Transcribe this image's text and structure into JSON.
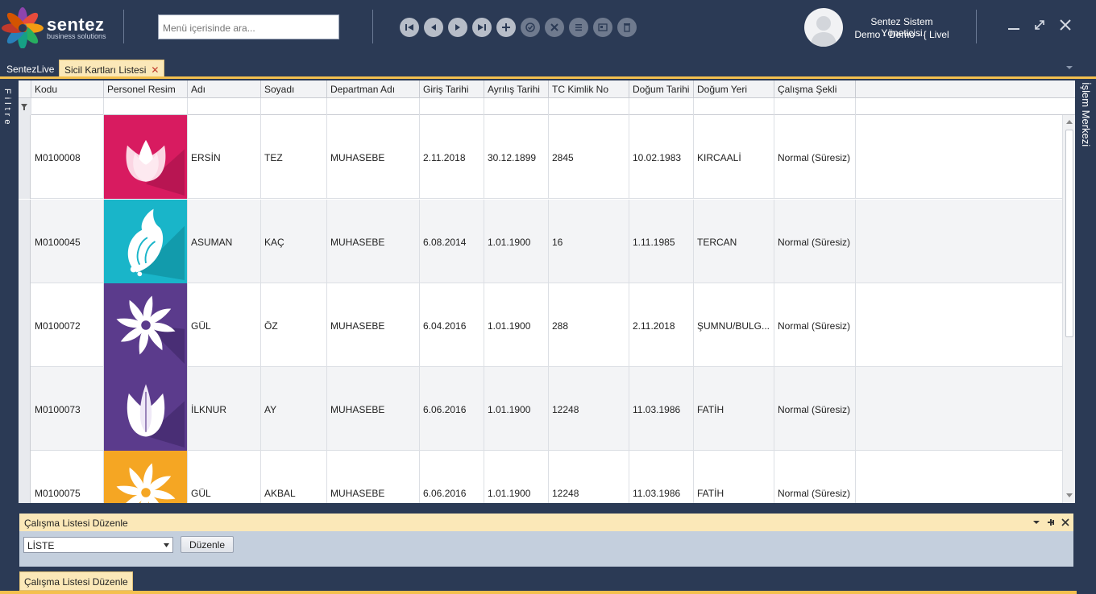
{
  "app": {
    "brand": "sentez",
    "brand_sub": "business solutions",
    "search_placeholder": "Menü içerisinde ara...",
    "user_name": "Sentez Sistem Yöneticisi",
    "user_context": "Demo - Demo - { Livel"
  },
  "toolbar": {
    "buttons": [
      {
        "name": "first-record-button",
        "icon": "skip-back-icon",
        "enabled": true
      },
      {
        "name": "previous-record-button",
        "icon": "play-back-icon",
        "enabled": true
      },
      {
        "name": "next-record-button",
        "icon": "play-icon",
        "enabled": true
      },
      {
        "name": "last-record-button",
        "icon": "skip-forward-icon",
        "enabled": true
      },
      {
        "name": "add-button",
        "icon": "plus-icon",
        "enabled": true
      },
      {
        "name": "approve-button",
        "icon": "check-circle-icon",
        "enabled": false
      },
      {
        "name": "cancel-button",
        "icon": "x-icon",
        "enabled": false
      },
      {
        "name": "list-button",
        "icon": "list-icon",
        "enabled": false
      },
      {
        "name": "card-button",
        "icon": "card-icon",
        "enabled": false
      },
      {
        "name": "delete-button",
        "icon": "trash-icon",
        "enabled": false
      }
    ]
  },
  "tabs": [
    {
      "label": "SentezLive",
      "active": false
    },
    {
      "label": "Sicil Kartları Listesi",
      "active": true,
      "closable": true
    }
  ],
  "side": {
    "left_label": "Filtre",
    "right_label": "İşlem Merkezi"
  },
  "grid": {
    "columns": [
      "Kodu",
      "Personel Resim",
      "Adı",
      "Soyadı",
      "Departman Adı",
      "Giriş Tarihi",
      "Ayrılış Tarihi",
      "TC Kimlik No",
      "Doğum Tarihi",
      "Doğum Yeri",
      "Çalışma Şekli"
    ],
    "rows": [
      {
        "kodu": "M0100008",
        "image": "tulip-pink",
        "adi": "ERSİN",
        "soyadi": "TEZ",
        "departman": "MUHASEBE",
        "giris": "2.11.2018",
        "ayrilis": "30.12.1899",
        "tc": "2845",
        "dogum": "10.02.1983",
        "dogum_yeri": "KIRCAALİ",
        "calisma": "Normal (Süresiz)"
      },
      {
        "kodu": "M0100045",
        "image": "tulip-cyan",
        "adi": "ASUMAN",
        "soyadi": "KAÇ",
        "departman": "MUHASEBE",
        "giris": "6.08.2014",
        "ayrilis": "1.01.1900",
        "tc": "16",
        "dogum": "1.11.1985",
        "dogum_yeri": "TERCAN",
        "calisma": "Normal (Süresiz)"
      },
      {
        "kodu": "M0100072",
        "image": "flower-purple",
        "adi": "GÜL",
        "soyadi": "ÖZ",
        "departman": "MUHASEBE",
        "giris": "6.04.2016",
        "ayrilis": "1.01.1900",
        "tc": "288",
        "dogum": "2.11.2018",
        "dogum_yeri": "ŞUMNU/BULG...",
        "calisma": "Normal (Süresiz)"
      },
      {
        "kodu": "M0100073",
        "image": "tulip-purple",
        "adi": "İLKNUR",
        "soyadi": "AY",
        "departman": "MUHASEBE",
        "giris": "6.06.2016",
        "ayrilis": "1.01.1900",
        "tc": "12248",
        "dogum": "11.03.1986",
        "dogum_yeri": "FATİH",
        "calisma": "Normal (Süresiz)"
      },
      {
        "kodu": "M0100075",
        "image": "flower-orange",
        "adi": "GÜL",
        "soyadi": "AKBAL",
        "departman": "MUHASEBE",
        "giris": "6.06.2016",
        "ayrilis": "1.01.1900",
        "tc": "12248",
        "dogum": "11.03.1986",
        "dogum_yeri": "FATİH",
        "calisma": "Normal (Süresiz)"
      }
    ]
  },
  "panel": {
    "title": "Çalışma Listesi Düzenle",
    "combo_value": "LİSTE",
    "button_label": "Düzenle",
    "bottom_tab": "Çalışma Listesi Düzenle"
  },
  "colors": {
    "background": "#2b3a55",
    "accent": "#f4c04e",
    "tab_active": "#fbe8b8",
    "tulip_pink": "#d81b60",
    "tulip_cyan": "#19b5c9",
    "purple": "#5b3b8c",
    "orange": "#f5a623"
  }
}
